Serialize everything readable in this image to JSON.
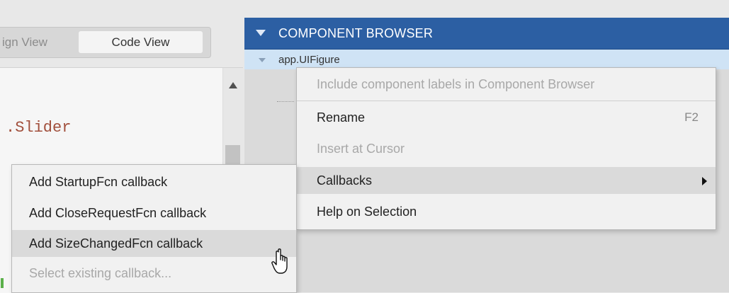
{
  "view_switch": {
    "design_view_label": "ign View",
    "code_view_label": "Code View"
  },
  "editor": {
    "code_snippet": ".Slider"
  },
  "component_browser": {
    "title": "COMPONENT BROWSER",
    "root_item": "app.UIFigure"
  },
  "context_menu": {
    "items": [
      {
        "label": "Include component labels in Component Browser",
        "enabled": false
      },
      {
        "label": "Rename",
        "shortcut": "F2",
        "enabled": true
      },
      {
        "label": "Insert at Cursor",
        "enabled": false
      },
      {
        "label": "Callbacks",
        "enabled": true,
        "highlighted": true,
        "has_submenu": true
      },
      {
        "label": "Help on Selection",
        "enabled": true
      }
    ]
  },
  "callbacks_submenu": {
    "items": [
      {
        "label": "Add StartupFcn callback",
        "enabled": true
      },
      {
        "label": "Add CloseRequestFcn callback",
        "enabled": true
      },
      {
        "label": "Add SizeChangedFcn callback",
        "enabled": true,
        "highlighted": true
      },
      {
        "label": "Select existing callback...",
        "enabled": false
      }
    ]
  },
  "icons": {
    "header_collapse": "triangle-down-icon",
    "tree_expand": "triangle-down-icon",
    "submenu_arrow": "triangle-right-icon",
    "cursor": "hand-pointer-icon",
    "scroll_up": "triangle-up-icon"
  },
  "colors": {
    "header_bg": "#2c5fa3",
    "selection_bg": "#cfe3f5",
    "menu_bg": "#f1f1f1",
    "menu_highlight": "#dadada",
    "code_color": "#a14f3c"
  }
}
